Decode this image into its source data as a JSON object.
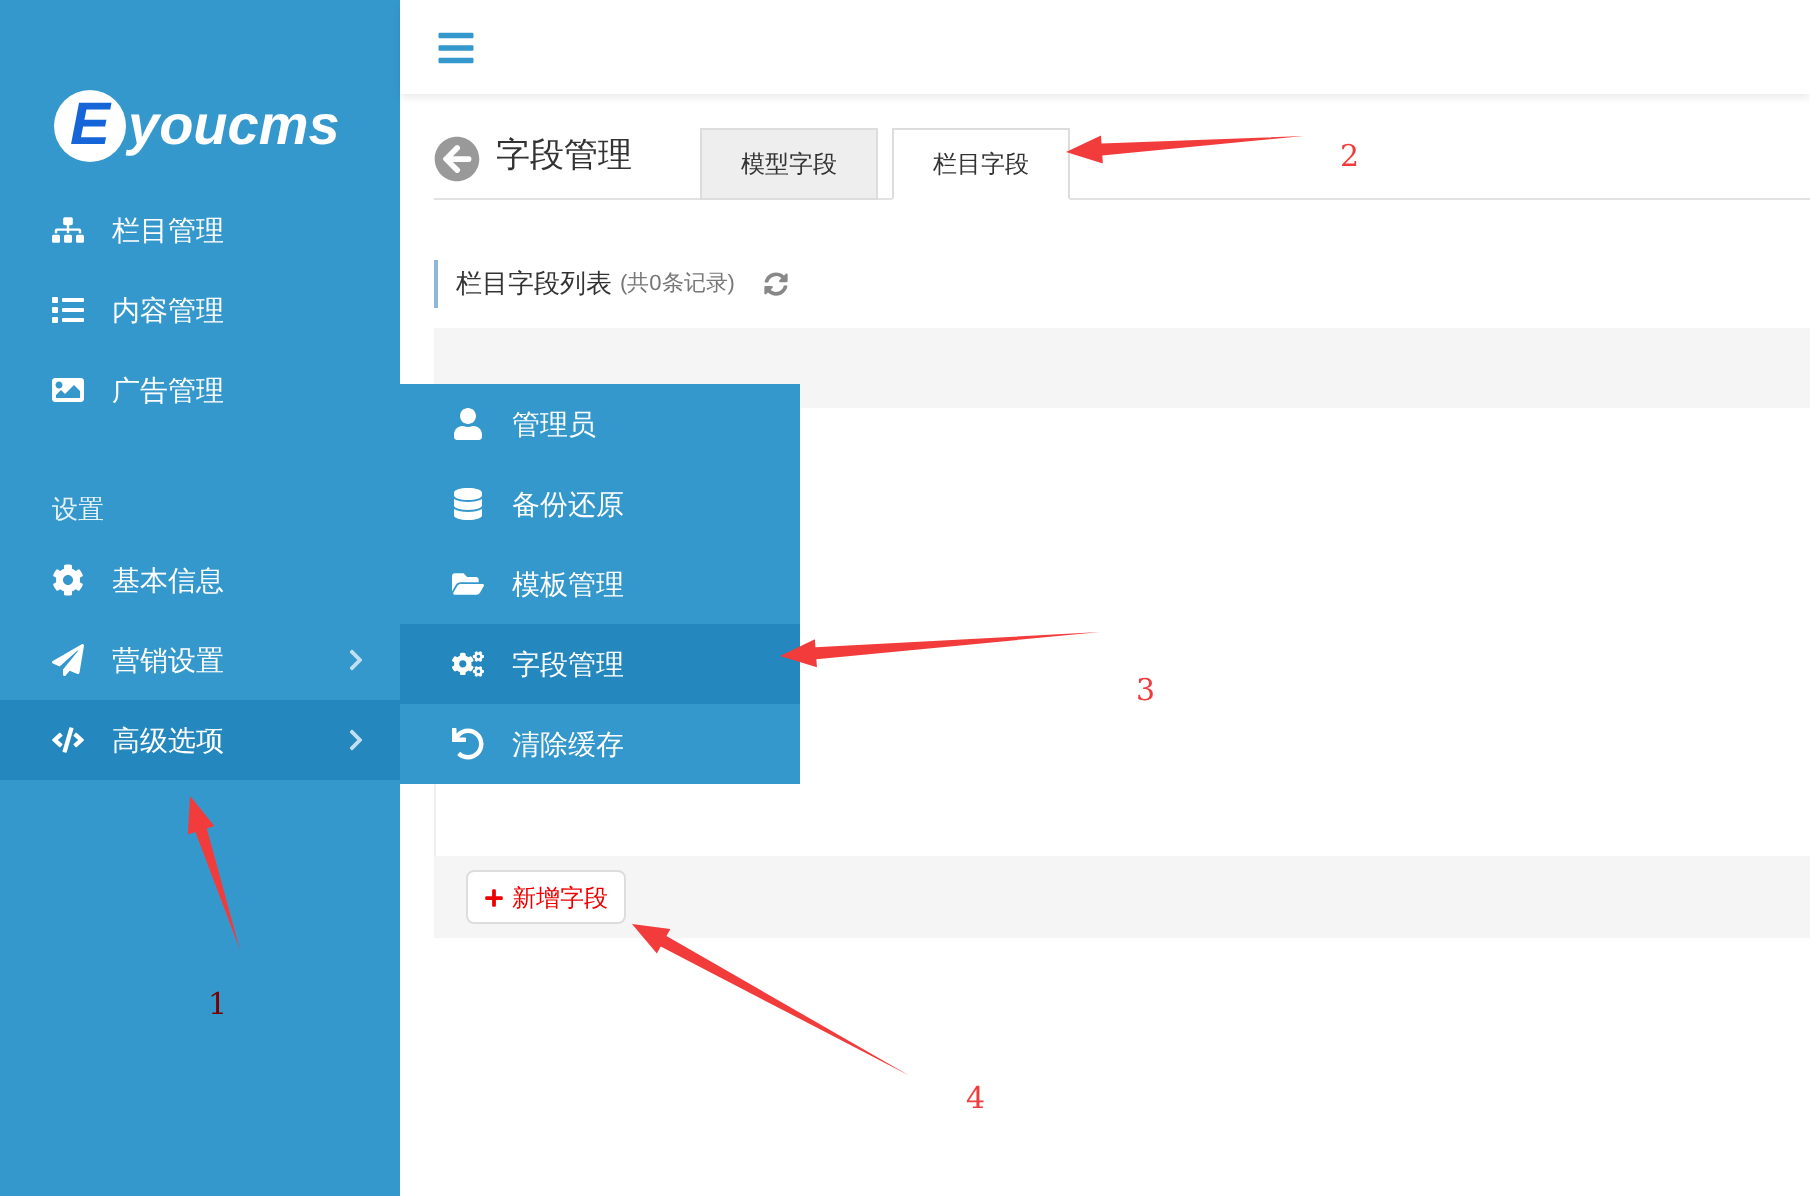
{
  "sidebar": {
    "logo": {
      "badge": "E",
      "text": "youcms"
    },
    "items": [
      {
        "label": "栏目管理",
        "selected": false,
        "submenu": false
      },
      {
        "label": "内容管理",
        "selected": false,
        "submenu": false
      },
      {
        "label": "广告管理",
        "selected": false,
        "submenu": false
      }
    ],
    "section": "设置",
    "settings_items": [
      {
        "label": "基本信息",
        "selected": false,
        "submenu": false
      },
      {
        "label": "营销设置",
        "selected": false,
        "submenu": true
      },
      {
        "label": "高级选项",
        "selected": true,
        "submenu": true
      }
    ]
  },
  "flyout_menu": [
    {
      "label": "管理员",
      "selected": false
    },
    {
      "label": "备份还原",
      "selected": false
    },
    {
      "label": "模板管理",
      "selected": false
    },
    {
      "label": "字段管理",
      "selected": true
    },
    {
      "label": "清除缓存",
      "selected": false
    }
  ],
  "page": {
    "title": "字段管理",
    "tabs": [
      {
        "label": "模型字段",
        "selected": false
      },
      {
        "label": "栏目字段",
        "selected": true
      }
    ],
    "list_title": "栏目字段列表",
    "record_count": "(共0条记录)",
    "add_button": "新增字段"
  },
  "annotations": [
    {
      "label": "1"
    },
    {
      "label": "2"
    },
    {
      "label": "3"
    },
    {
      "label": "4"
    }
  ]
}
